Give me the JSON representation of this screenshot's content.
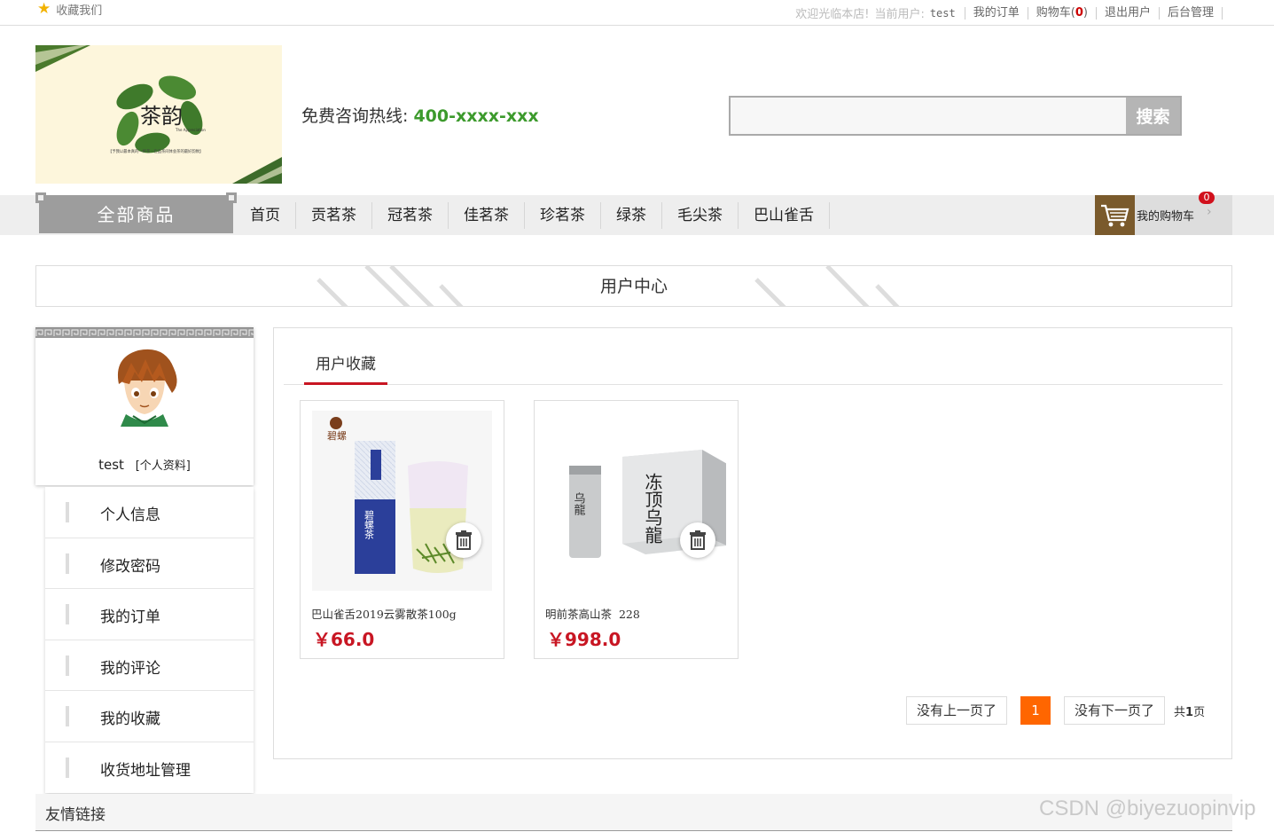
{
  "topbar": {
    "favorite": "收藏我们",
    "welcome": "欢迎光临本店!",
    "current_user_label": "当前用户:",
    "username": "test",
    "my_orders": "我的订单",
    "cart_label": "购物车",
    "cart_open": "(",
    "cart_count": "0",
    "cart_close": ")",
    "logout": "退出用户",
    "admin": "后台管理"
  },
  "header": {
    "hotline_label": "免费咨询热线:",
    "hotline_number": "400-xxxx-xxx",
    "search_placeholder": "",
    "search_button": "搜索",
    "logo_text_main": "茶韵",
    "logo_text_sub": "The Appreciation",
    "logo_slogan": "【予我以最本真的一杯茶 · 在品茶间体会茶的最好韵致】"
  },
  "nav": {
    "all_goods": "全部商品",
    "items": [
      "首页",
      "贡茗茶",
      "冠茗茶",
      "佳茗茶",
      "珍茗茶",
      "绿茶",
      "毛尖茶",
      "巴山雀舌"
    ],
    "my_cart": "我的购物车",
    "cart_badge": "0"
  },
  "page_title": "用户中心",
  "profile": {
    "username": "test",
    "info_link": "[个人资料]"
  },
  "menu": [
    "个人信息",
    "修改密码",
    "我的订单",
    "我的评论",
    "我的收藏",
    "收货地址管理"
  ],
  "favorites": {
    "tab": "用户收藏",
    "items": [
      {
        "name": "巴山雀舌2019云雾散茶100g",
        "price": "￥66.0",
        "brand": "碧螺",
        "pack_text": "碧螺茶"
      },
      {
        "name": "明前茶高山茶  228",
        "price": "￥998.0",
        "brand": "",
        "pack_text": "冻顶乌龍"
      }
    ]
  },
  "pager": {
    "prev": "没有上一页了",
    "current": "1",
    "next": "没有下一页了",
    "total_prefix": "共",
    "total": "1",
    "total_suffix": "页"
  },
  "footer": {
    "friends": "友情链接",
    "watermark": "CSDN @biyezuopinvip"
  },
  "colors": {
    "accent_red": "#c81623",
    "hotline_green": "#3c9a2c",
    "pager_orange": "#ff6600",
    "cart_brown": "#7a5a2c"
  }
}
